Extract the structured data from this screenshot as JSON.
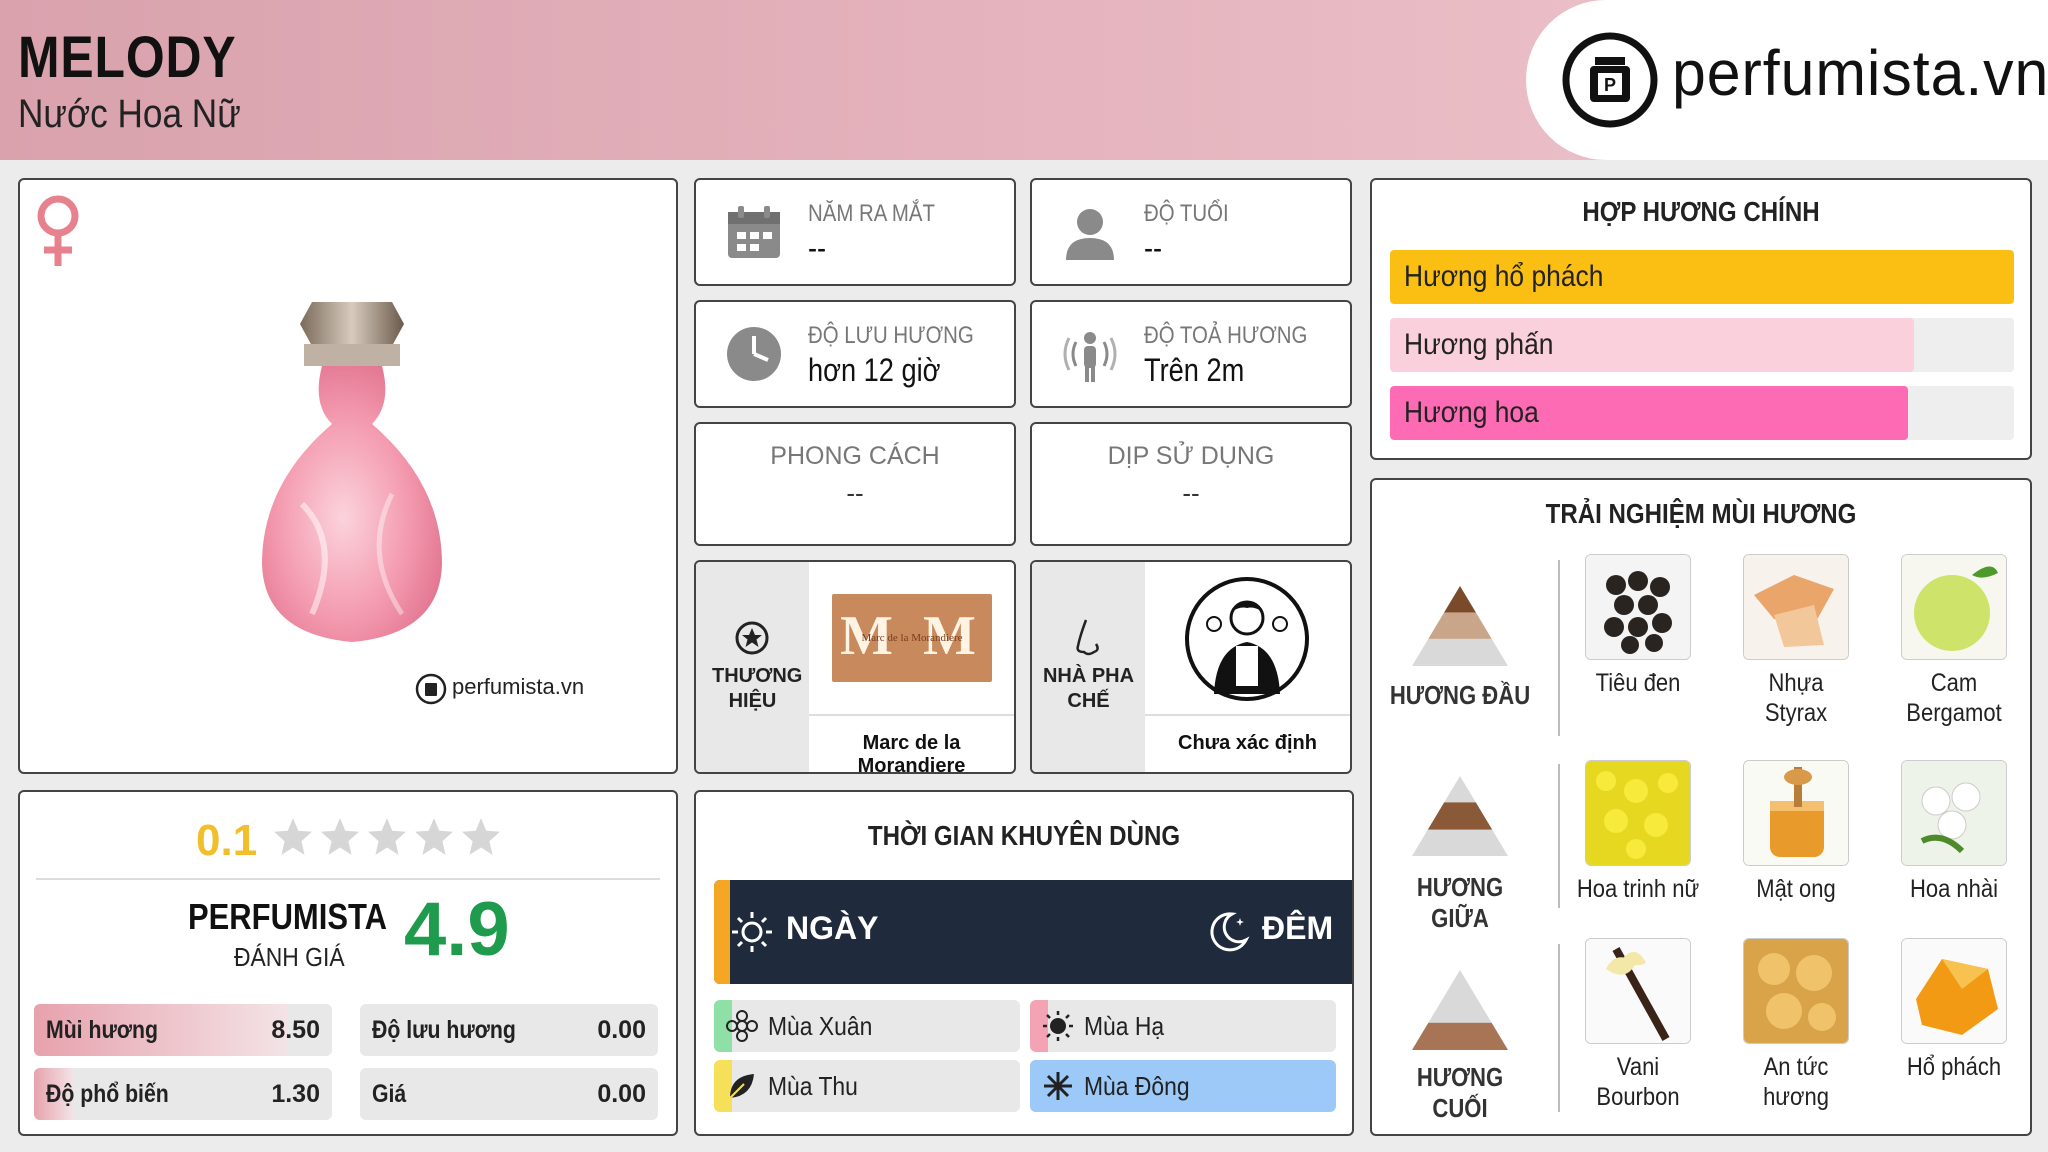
{
  "header": {
    "title": "MELODY",
    "subtitle": "Nước Hoa Nữ",
    "brand_site": "perfumista.vn",
    "background_color": "#e3b0ba"
  },
  "product": {
    "gender_icon": "female-symbol-icon",
    "watermark": "perfumista.vn"
  },
  "info": {
    "release_year": {
      "label": "NĂM RA MẮT",
      "value": "--",
      "icon": "calendar-icon"
    },
    "age": {
      "label": "ĐỘ TUỔI",
      "value": "--",
      "icon": "user-icon"
    },
    "longevity": {
      "label": "ĐỘ LƯU HƯƠNG",
      "value": "hơn 12 giờ",
      "icon": "clock-icon"
    },
    "sillage": {
      "label": "ĐỘ TOẢ HƯƠNG",
      "value": "Trên 2m",
      "icon": "radiating-person-icon"
    },
    "style": {
      "label": "PHONG CÁCH",
      "value": "--"
    },
    "occasion": {
      "label": "DỊP SỬ DỤNG",
      "value": "--"
    }
  },
  "brand": {
    "label": "THƯƠNG HIỆU",
    "name": "Marc de la Morandiere",
    "logo_text": "M M",
    "logo_small": "Marc de la Morandiere"
  },
  "perfumer": {
    "label": "NHÀ PHA CHẾ",
    "name": "Chưa xác định"
  },
  "rating": {
    "user_score": "0.1",
    "stars_filled": 0,
    "stars_total": 5,
    "brand_label": "PERFUMISTA",
    "brand_sublabel": "ĐÁNH GIÁ",
    "score": "4.9",
    "metrics": [
      {
        "label": "Mùi hương",
        "value": "8.50",
        "fill": 0.85
      },
      {
        "label": "Độ lưu hương",
        "value": "0.00",
        "fill": 0
      },
      {
        "label": "Độ phổ biến",
        "value": "1.30",
        "fill": 0.13
      },
      {
        "label": "Giá",
        "value": "0.00",
        "fill": 0
      }
    ]
  },
  "usage": {
    "title": "THỜI GIAN KHUYÊN DÙNG",
    "day_label": "NGÀY",
    "night_label": "ĐÊM",
    "seasons": [
      {
        "label": "Mùa Xuân",
        "icon": "flower-icon",
        "color": "#8ee0a6",
        "highlight": false
      },
      {
        "label": "Mùa Hạ",
        "icon": "sun-icon",
        "color": "#f4a3b4",
        "highlight": false
      },
      {
        "label": "Mùa Thu",
        "icon": "leaf-icon",
        "color": "#f6e05a",
        "highlight": false
      },
      {
        "label": "Mùa Đông",
        "icon": "snowflake-icon",
        "color": "#9cc9f8",
        "highlight": true
      }
    ]
  },
  "accords": {
    "title": "HỢP HƯƠNG CHÍNH",
    "items": [
      {
        "label": "Hương hổ phách",
        "fill": 1.0,
        "color": "#fbbf13"
      },
      {
        "label": "Hương phấn",
        "fill": 0.84,
        "color": "#fad0dc"
      },
      {
        "label": "Hương hoa",
        "fill": 0.83,
        "color": "#fd6bb4"
      }
    ]
  },
  "notes": {
    "title": "TRẢI NGHIỆM MÙI HƯƠNG",
    "top": {
      "label": "HƯƠNG ĐẦU",
      "items": [
        "Tiêu đen",
        "Nhựa Styrax",
        "Cam Bergamot"
      ]
    },
    "middle": {
      "label": "HƯƠNG GIỮA",
      "items": [
        "Hoa trinh nữ",
        "Mật ong",
        "Hoa nhài"
      ]
    },
    "base": {
      "label": "HƯƠNG CUỐI",
      "items": [
        "Vani Bourbon",
        "An tức hương",
        "Hổ phách"
      ]
    }
  }
}
